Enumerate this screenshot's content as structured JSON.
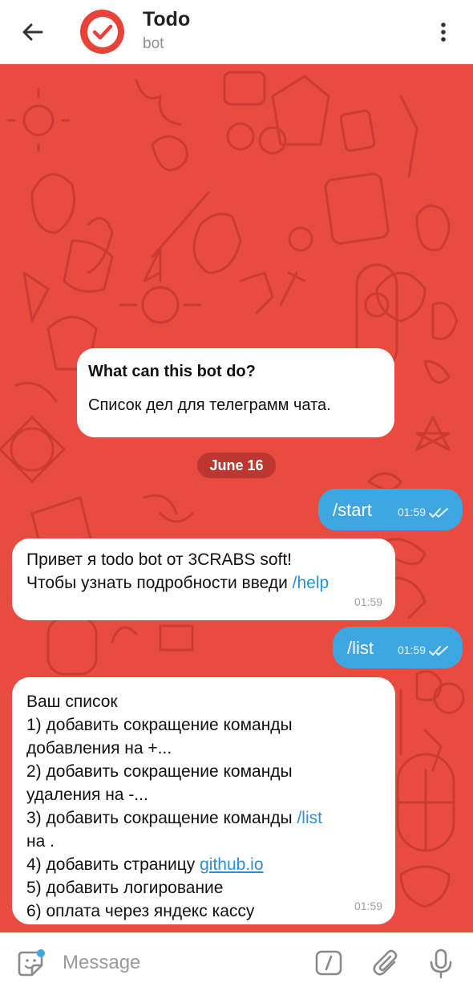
{
  "header": {
    "title": "Todo",
    "subtitle": "bot",
    "back_icon": "arrow-left-icon",
    "more_icon": "more-vertical-icon",
    "avatar_icon": "checkmark-icon",
    "avatar_color": "#e8433b"
  },
  "chat": {
    "background_color": "#e84b40",
    "intro": {
      "title": "What can this bot do?",
      "text": "Список дел для телеграмм чата."
    },
    "date": "June 16",
    "messages": [
      {
        "direction": "out",
        "text": "/start",
        "time": "01:59"
      },
      {
        "direction": "in",
        "line1": "Привет я todo bot от 3CRABS soft!",
        "line2_text": "Чтобы узнать подробности введи ",
        "line2_link": "/help",
        "time": "01:59"
      },
      {
        "direction": "out",
        "text": "/list",
        "time": "01:59"
      },
      {
        "direction": "in",
        "lines": {
          "l1": "Ваш список",
          "l2": "1) добавить сокращение команды",
          "l3": "добавления на +...",
          "l4": "2) добавить сокращение команды",
          "l5": "удаления на -...",
          "l6_text": "3) добавить сокращение команды ",
          "l6_link": "/list",
          "l7": "на .",
          "l8_text": "4) добавить страницу ",
          "l8_link": "github.io",
          "l9": "5) добавить логирование",
          "l10": "6) оплата через яндекс кассу"
        },
        "time": "01:59"
      }
    ]
  },
  "input": {
    "placeholder": "Message",
    "emoji_icon": "sticker-icon",
    "command_icon": "slash-command-icon",
    "attach_icon": "paperclip-icon",
    "mic_icon": "microphone-icon"
  },
  "colors": {
    "accent": "#3ea6e0",
    "link": "#2b8fd6"
  }
}
